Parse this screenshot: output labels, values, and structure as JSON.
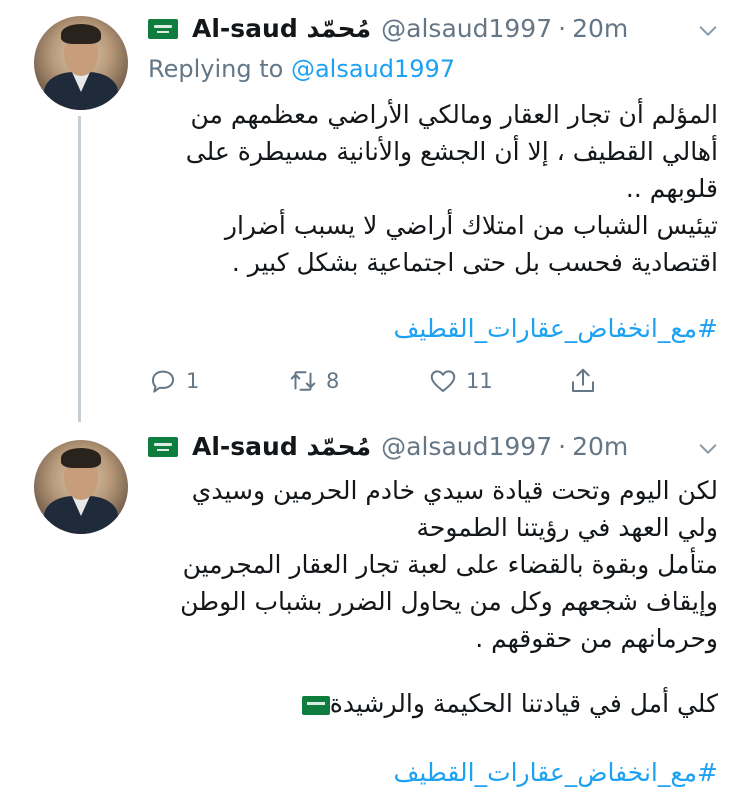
{
  "tweets": [
    {
      "name": "Al-saud مُحمّد",
      "handle": "@alsaud1997",
      "separator": "·",
      "time": "20m",
      "replying_label": "Replying to",
      "replying_to": "@alsaud1997",
      "lines": [
        "المؤلم أن تجار العقار ومالكي الأراضي معظمهم من أهالي القطيف ، إلا أن الجشع والأنانية مسيطرة على قلوبهم ..",
        "تيئيس الشباب من امتلاك أراضي لا يسبب أضرار اقتصادية فحسب بل حتى اجتماعية بشكل كبير ."
      ],
      "hashtag": "#مع_انخفاض_عقارات_القطيف",
      "actions": {
        "reply_count": "1",
        "retweet_count": "8",
        "like_count": "11",
        "share_label": ""
      }
    },
    {
      "name": "Al-saud مُحمّد",
      "handle": "@alsaud1997",
      "separator": "·",
      "time": "20m",
      "lines": [
        "لكن اليوم وتحت قيادة سيدي خادم الحرمين وسيدي ولي العهد في رؤيتنا الطموحة",
        "متأمل وبقوة بالقضاء على لعبة تجار العقار المجرمين وإيقاف شجعهم وكل من يحاول الضرر بشباب الوطن وحرمانهم من حقوقهم ."
      ],
      "closing": "كلي أمل في قيادتنا الحكيمة والرشيدة",
      "hashtag": "#مع_انخفاض_عقارات_القطيف"
    }
  ],
  "icons": {
    "flag": "saudi-flag-icon",
    "chevron": "chevron-down-icon",
    "reply": "reply-icon",
    "retweet": "retweet-icon",
    "like": "heart-icon",
    "share": "share-icon"
  },
  "colors": {
    "link": "#1da1f2",
    "secondary": "#657786",
    "flag": "#0f7d3e",
    "thread_line": "#c4cfd6"
  }
}
